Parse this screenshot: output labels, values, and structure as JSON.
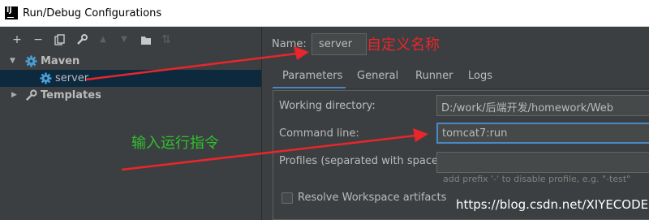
{
  "window": {
    "title": "Run/Debug Configurations"
  },
  "toolbar": {
    "add": "+",
    "remove": "−",
    "copy": "⧉",
    "edit": "🔧",
    "move_up": "▲",
    "move_down": "▼",
    "folder": "📁",
    "sort": "⇅"
  },
  "tree": {
    "maven": {
      "label": "Maven"
    },
    "server": {
      "label": "server"
    },
    "templates": {
      "label": "Templates"
    }
  },
  "config": {
    "name_label": "Name:",
    "name_value": "server",
    "tabs": [
      "Parameters",
      "General",
      "Runner",
      "Logs"
    ],
    "working_directory_label": "Working directory:",
    "working_directory_value": "D:/work/后端开发/homework/Web",
    "command_line_label": "Command line:",
    "command_line_value": "tomcat7:run",
    "profiles_label": "Profiles (separated with space):",
    "profiles_value": "",
    "profiles_hint": "add prefix '-' to disable profile, e.g. \"-test\"",
    "resolve_workspace_label": "Resolve Workspace artifacts"
  },
  "annotations": {
    "custom_name": "自定义名称",
    "enter_command": "输入运行指令"
  },
  "watermark": "https://blog.csdn.net/XIYECODE",
  "colors": {
    "accent": "#4a88c7",
    "selection": "#0d293e",
    "annotation_red": "#e8262b",
    "annotation_green": "#2fc02e",
    "gear": "#4a9fd8"
  }
}
